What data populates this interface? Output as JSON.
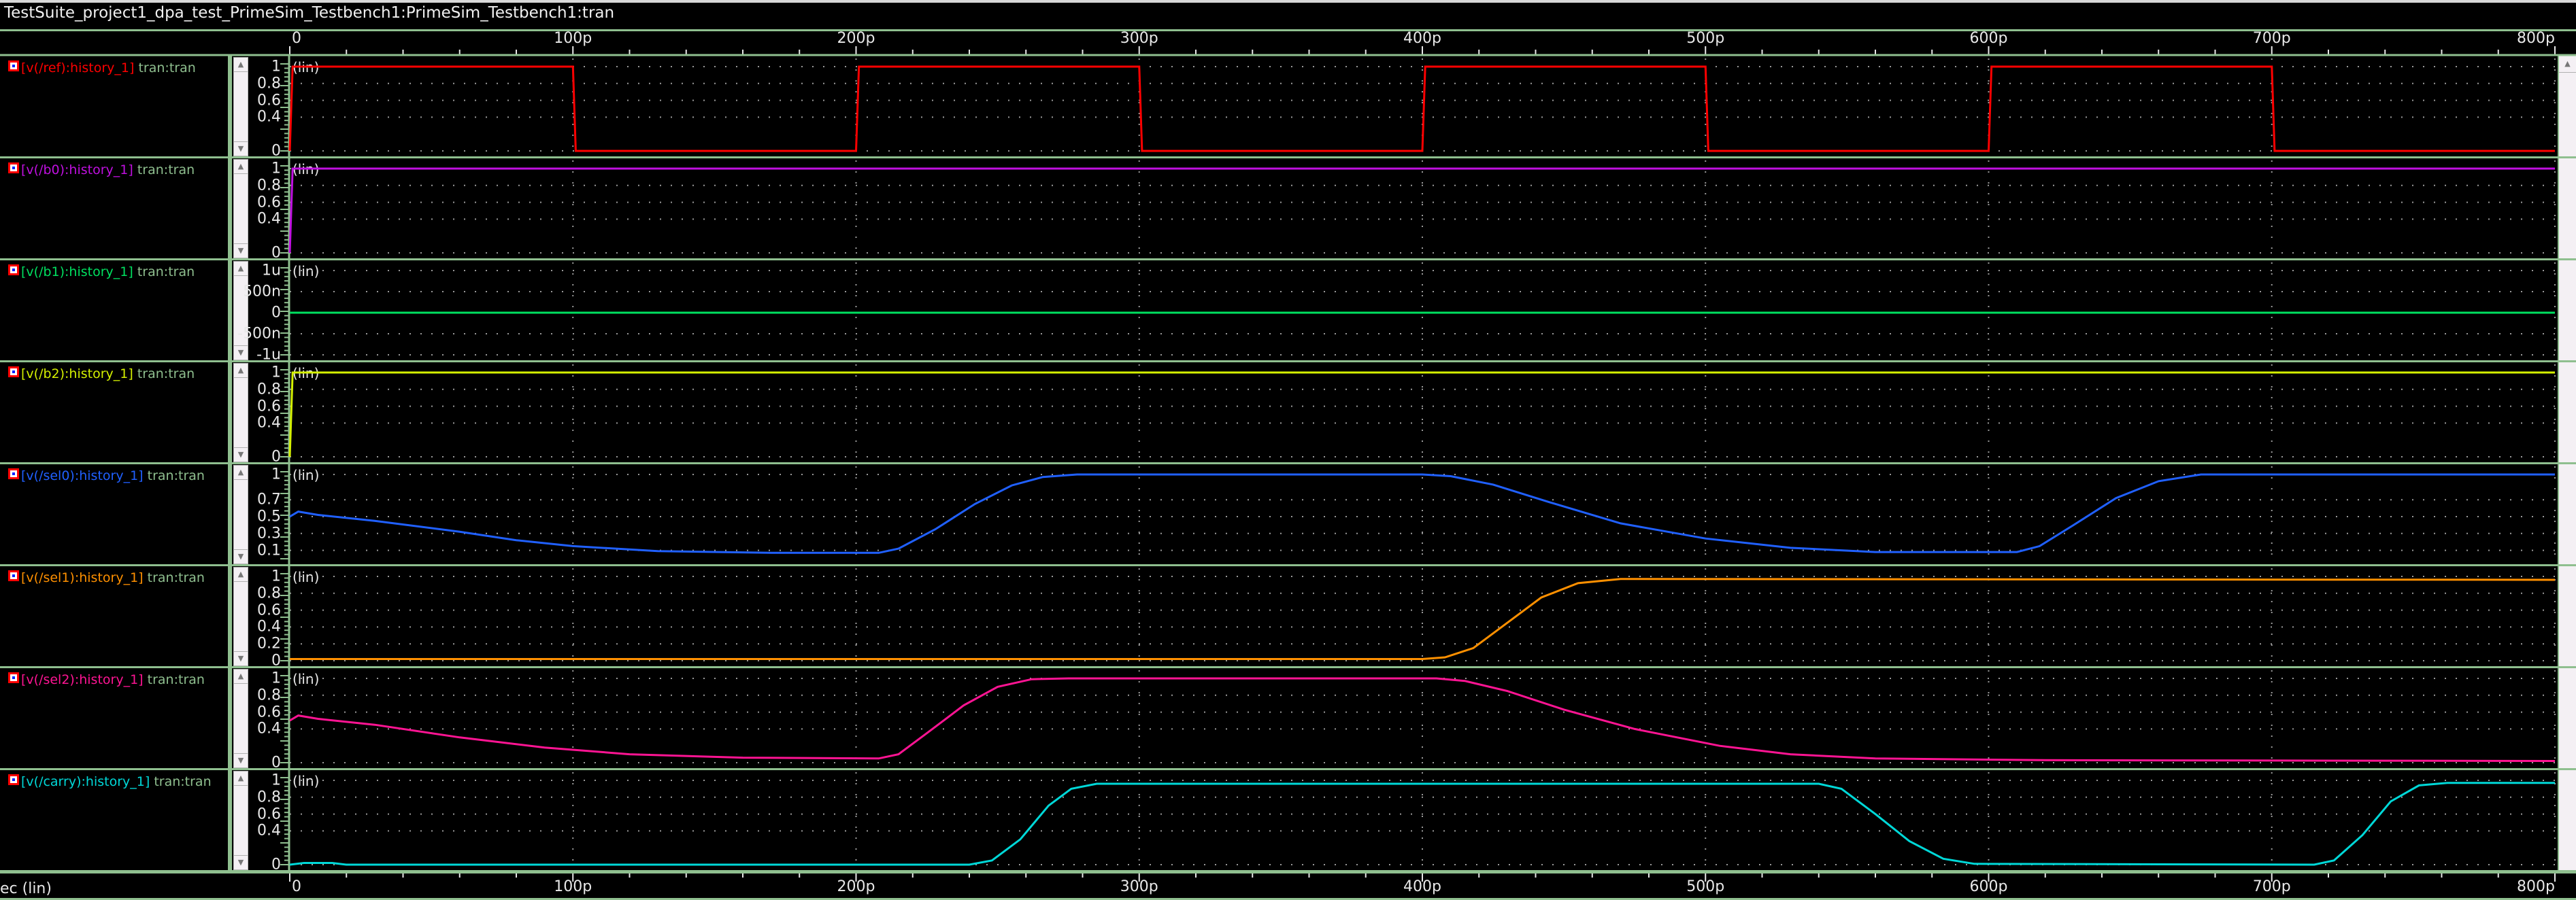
{
  "window": {
    "title": "TestSuite_project1_dpa_test_PrimeSim_Testbench1:PrimeSim_Testbench1:tran"
  },
  "x_axis": {
    "unit_label": "ec (lin)",
    "ticks": [
      "0",
      "100p",
      "200p",
      "300p",
      "400p",
      "500p",
      "600p",
      "700p",
      "800p"
    ],
    "range_ps": [
      0,
      800
    ]
  },
  "chart_data": {
    "type": "line",
    "xlabel": "ec (lin)",
    "xlim": [
      0,
      800
    ],
    "x_unit": "ps",
    "grid": true,
    "panels": [
      {
        "name": "[v(/ref):history_1]",
        "source": "tran:tran",
        "scale": "(lin)",
        "color": "#ff0000",
        "yticks": [
          "1",
          "0.8",
          "0.6",
          "0.4",
          "0"
        ],
        "ytick_values": [
          1,
          0.8,
          0.6,
          0.4,
          0
        ],
        "ylim": [
          0,
          1
        ],
        "points": [
          [
            0,
            0
          ],
          [
            1,
            1
          ],
          [
            100,
            1
          ],
          [
            101,
            0
          ],
          [
            200,
            0
          ],
          [
            201,
            1
          ],
          [
            300,
            1
          ],
          [
            301,
            0
          ],
          [
            400,
            0
          ],
          [
            401,
            1
          ],
          [
            500,
            1
          ],
          [
            501,
            0
          ],
          [
            600,
            0
          ],
          [
            601,
            1
          ],
          [
            700,
            1
          ],
          [
            701,
            0
          ],
          [
            800,
            0
          ]
        ]
      },
      {
        "name": "[v(/b0):history_1]",
        "source": "tran:tran",
        "scale": "(lin)",
        "color": "#c010e0",
        "yticks": [
          "1",
          "0.8",
          "0.6",
          "0.4",
          "0"
        ],
        "ytick_values": [
          1,
          0.8,
          0.6,
          0.4,
          0
        ],
        "ylim": [
          0,
          1
        ],
        "points": [
          [
            0,
            0
          ],
          [
            1,
            1
          ],
          [
            800,
            1
          ]
        ]
      },
      {
        "name": "[v(/b1):history_1]",
        "source": "tran:tran",
        "scale": "(lin)",
        "color": "#00e060",
        "yticks": [
          "1u",
          "500n",
          "0",
          "-500n",
          "-1u"
        ],
        "ytick_values": [
          1,
          0.75,
          0.5,
          0.25,
          0
        ],
        "ylim": [
          0,
          1
        ],
        "points": [
          [
            0,
            0.5
          ],
          [
            800,
            0.5
          ]
        ]
      },
      {
        "name": "[v(/b2):history_1]",
        "source": "tran:tran",
        "scale": "(lin)",
        "color": "#d4f000",
        "yticks": [
          "1",
          "0.8",
          "0.6",
          "0.4",
          "0"
        ],
        "ytick_values": [
          1,
          0.8,
          0.6,
          0.4,
          0
        ],
        "ylim": [
          0,
          1
        ],
        "points": [
          [
            0,
            0
          ],
          [
            1,
            1
          ],
          [
            800,
            1
          ]
        ]
      },
      {
        "name": "[v(/sel0):history_1]",
        "source": "tran:tran",
        "scale": "(lin)",
        "color": "#2060ff",
        "yticks": [
          "1",
          "0.7",
          "0.5",
          "0.3",
          "0.1"
        ],
        "ytick_values": [
          1,
          0.7,
          0.5,
          0.3,
          0.1
        ],
        "ylim": [
          0,
          1
        ],
        "points": [
          [
            0,
            0.5
          ],
          [
            3,
            0.56
          ],
          [
            10,
            0.52
          ],
          [
            30,
            0.45
          ],
          [
            60,
            0.32
          ],
          [
            80,
            0.22
          ],
          [
            100,
            0.15
          ],
          [
            130,
            0.09
          ],
          [
            170,
            0.07
          ],
          [
            208,
            0.07
          ],
          [
            215,
            0.12
          ],
          [
            228,
            0.35
          ],
          [
            242,
            0.65
          ],
          [
            255,
            0.87
          ],
          [
            266,
            0.97
          ],
          [
            278,
            1.0
          ],
          [
            400,
            1.0
          ],
          [
            410,
            0.98
          ],
          [
            425,
            0.88
          ],
          [
            445,
            0.67
          ],
          [
            470,
            0.42
          ],
          [
            500,
            0.24
          ],
          [
            530,
            0.13
          ],
          [
            560,
            0.08
          ],
          [
            610,
            0.08
          ],
          [
            618,
            0.15
          ],
          [
            630,
            0.4
          ],
          [
            645,
            0.72
          ],
          [
            660,
            0.92
          ],
          [
            675,
            1.0
          ],
          [
            800,
            1.0
          ]
        ]
      },
      {
        "name": "[v(/sel1):history_1]",
        "source": "tran:tran",
        "scale": "(lin)",
        "color": "#ff9000",
        "yticks": [
          "1",
          "0.8",
          "0.6",
          "0.4",
          "0.2",
          "0"
        ],
        "ytick_values": [
          1,
          0.8,
          0.6,
          0.4,
          0.2,
          0
        ],
        "ylim": [
          0,
          1
        ],
        "points": [
          [
            0,
            0.02
          ],
          [
            400,
            0.02
          ],
          [
            408,
            0.04
          ],
          [
            418,
            0.15
          ],
          [
            430,
            0.45
          ],
          [
            442,
            0.75
          ],
          [
            455,
            0.92
          ],
          [
            470,
            0.97
          ],
          [
            800,
            0.96
          ]
        ]
      },
      {
        "name": "[v(/sel2):history_1]",
        "source": "tran:tran",
        "scale": "(lin)",
        "color": "#ff1493",
        "yticks": [
          "1",
          "0.8",
          "0.6",
          "0.4",
          "0"
        ],
        "ytick_values": [
          1,
          0.8,
          0.6,
          0.4,
          0
        ],
        "ylim": [
          0,
          1
        ],
        "points": [
          [
            0,
            0.5
          ],
          [
            3,
            0.56
          ],
          [
            10,
            0.52
          ],
          [
            30,
            0.45
          ],
          [
            60,
            0.3
          ],
          [
            90,
            0.18
          ],
          [
            120,
            0.1
          ],
          [
            160,
            0.06
          ],
          [
            208,
            0.05
          ],
          [
            215,
            0.1
          ],
          [
            225,
            0.35
          ],
          [
            238,
            0.68
          ],
          [
            250,
            0.9
          ],
          [
            262,
            0.99
          ],
          [
            275,
            1.0
          ],
          [
            405,
            1.0
          ],
          [
            415,
            0.97
          ],
          [
            430,
            0.85
          ],
          [
            450,
            0.63
          ],
          [
            475,
            0.4
          ],
          [
            505,
            0.2
          ],
          [
            530,
            0.1
          ],
          [
            560,
            0.05
          ],
          [
            620,
            0.03
          ],
          [
            800,
            0.02
          ]
        ]
      },
      {
        "name": "[v(/carry):history_1]",
        "source": "tran:tran",
        "scale": "(lin)",
        "color": "#00d8d8",
        "yticks": [
          "1",
          "0.8",
          "0.6",
          "0.4",
          "0"
        ],
        "ytick_values": [
          1,
          0.8,
          0.6,
          0.4,
          0
        ],
        "ylim": [
          0,
          1
        ],
        "points": [
          [
            0,
            0.0
          ],
          [
            5,
            0.02
          ],
          [
            15,
            0.02
          ],
          [
            20,
            0.0
          ],
          [
            240,
            0.0
          ],
          [
            248,
            0.05
          ],
          [
            258,
            0.3
          ],
          [
            268,
            0.7
          ],
          [
            276,
            0.9
          ],
          [
            285,
            0.96
          ],
          [
            540,
            0.96
          ],
          [
            548,
            0.9
          ],
          [
            560,
            0.6
          ],
          [
            572,
            0.28
          ],
          [
            584,
            0.07
          ],
          [
            595,
            0.01
          ],
          [
            715,
            0.0
          ],
          [
            722,
            0.05
          ],
          [
            732,
            0.35
          ],
          [
            742,
            0.75
          ],
          [
            752,
            0.94
          ],
          [
            762,
            0.97
          ],
          [
            800,
            0.97
          ]
        ]
      }
    ]
  },
  "colors": {
    "grid": "#8fbf8f",
    "source_label": "#8fbf8f",
    "background": "#000000"
  },
  "icons": {
    "trace_marker": "trace-visibility-icon",
    "scroll_up": "arrow-up-icon",
    "scroll_down": "arrow-down-icon"
  }
}
